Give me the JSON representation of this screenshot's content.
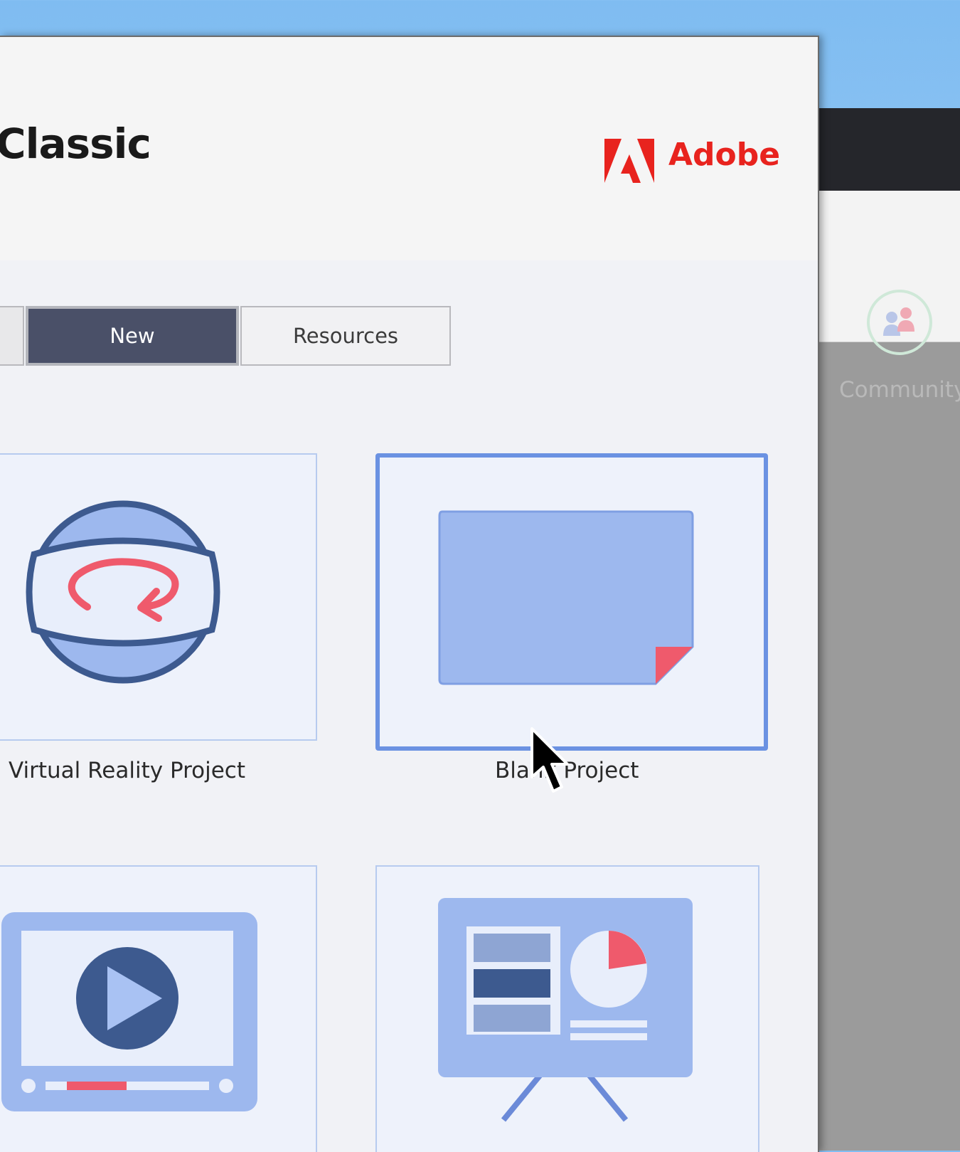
{
  "dialog": {
    "title": "Classic",
    "brand": "Adobe"
  },
  "tabs": [
    {
      "label": "New",
      "selected": true
    },
    {
      "label": "Resources",
      "selected": false
    }
  ],
  "projects": [
    {
      "label": "Virtual Reality Project",
      "icon": "vr-headset-icon"
    },
    {
      "label": "Blank Project",
      "icon": "blank-slide-icon",
      "selected": true
    },
    {
      "label": "",
      "icon": "video-player-icon"
    },
    {
      "label": "",
      "icon": "presentation-board-icon"
    }
  ],
  "background_app": {
    "toolbar_item": "Community",
    "icon": "community-icon"
  },
  "colors": {
    "accent": "#6b92e2",
    "tab_selected": "#4a5068",
    "brand_red": "#e8231e",
    "icon_dark": "#3d5a8f",
    "icon_light": "#9db8ee",
    "icon_red": "#ef5a6c"
  }
}
